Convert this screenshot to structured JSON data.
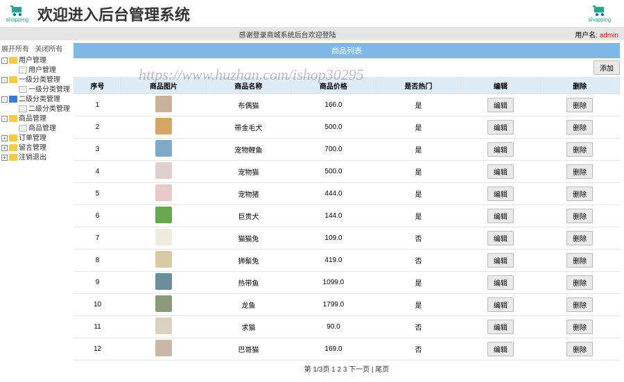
{
  "header": {
    "logo_text": "shopping",
    "title": "欢迎进入后台管理系统"
  },
  "subheader": {
    "center": "感谢登录商城系统后台欢迎登陆",
    "user_label": "用户名:",
    "user_value": "admin"
  },
  "sidebar": {
    "expand_all": "展开所有",
    "collapse_all": "关闭所有",
    "tree": [
      {
        "level": 1,
        "toggle": "-",
        "icon": "folder-y",
        "label": "用户管理"
      },
      {
        "level": 2,
        "toggle": "",
        "icon": "file",
        "label": "用户管理"
      },
      {
        "level": 1,
        "toggle": "-",
        "icon": "folder-y",
        "label": "一级分类管理"
      },
      {
        "level": 2,
        "toggle": "",
        "icon": "file",
        "label": "一级分类管理"
      },
      {
        "level": 1,
        "toggle": "-",
        "icon": "folder-b",
        "label": "二级分类管理"
      },
      {
        "level": 2,
        "toggle": "",
        "icon": "file",
        "label": "二级分类管理"
      },
      {
        "level": 1,
        "toggle": "-",
        "icon": "folder-y",
        "label": "商品管理"
      },
      {
        "level": 2,
        "toggle": "",
        "icon": "file",
        "label": "商品管理"
      },
      {
        "level": 1,
        "toggle": "+",
        "icon": "folder-y",
        "label": "订单管理"
      },
      {
        "level": 1,
        "toggle": "+",
        "icon": "folder-y",
        "label": "留言管理"
      },
      {
        "level": 1,
        "toggle": "+",
        "icon": "folder-y",
        "label": "注销退出"
      }
    ]
  },
  "panel": {
    "title": "商品列表",
    "add_label": "添加"
  },
  "table": {
    "headers": [
      "序号",
      "商品图片",
      "商品名称",
      "商品价格",
      "是否热门",
      "编辑",
      "删除"
    ],
    "edit_label": "编辑",
    "delete_label": "删除",
    "rows": [
      {
        "idx": "1",
        "name": "布偶猫",
        "price": "166.0",
        "hot": "是"
      },
      {
        "idx": "2",
        "name": "带金毛犬",
        "price": "500.0",
        "hot": "是"
      },
      {
        "idx": "3",
        "name": "宠物鲤鱼",
        "price": "700.0",
        "hot": "是"
      },
      {
        "idx": "4",
        "name": "宠物猫",
        "price": "500.0",
        "hot": "是"
      },
      {
        "idx": "5",
        "name": "宠物猪",
        "price": "444.0",
        "hot": "是"
      },
      {
        "idx": "6",
        "name": "巨贵犬",
        "price": "144.0",
        "hot": "是"
      },
      {
        "idx": "7",
        "name": "猫猫兔",
        "price": "109.0",
        "hot": "否"
      },
      {
        "idx": "8",
        "name": "狮鬃兔",
        "price": "419.0",
        "hot": "否"
      },
      {
        "idx": "9",
        "name": "热带鱼",
        "price": "1099.0",
        "hot": "是"
      },
      {
        "idx": "10",
        "name": "龙鱼",
        "price": "1799.0",
        "hot": "是"
      },
      {
        "idx": "11",
        "name": "求猫",
        "price": "90.0",
        "hot": "否"
      },
      {
        "idx": "12",
        "name": "巴哥猫",
        "price": "169.0",
        "hot": "否"
      }
    ]
  },
  "pager": {
    "text": "第 1/3页 1 2 3 下一页 | 尾页"
  },
  "watermark": "https://www.huzhan.com/ishop30295"
}
